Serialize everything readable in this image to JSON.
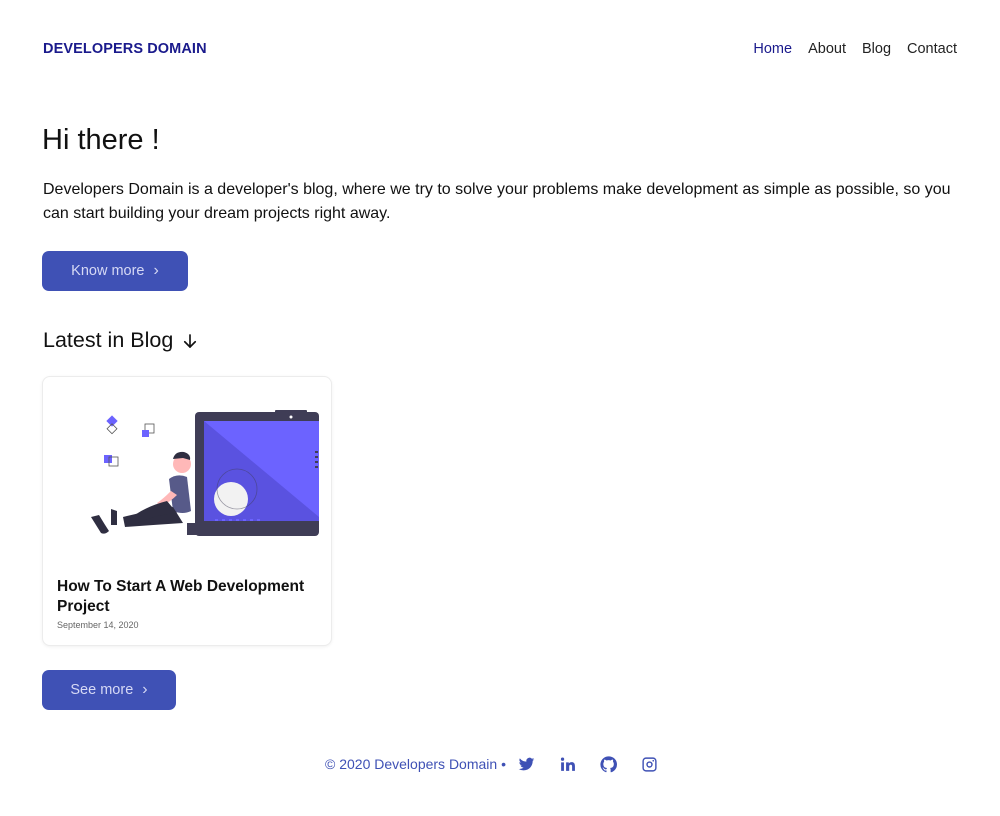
{
  "header": {
    "brand": "DEVELOPERS DOMAIN",
    "nav": [
      {
        "label": "Home",
        "active": true
      },
      {
        "label": "About",
        "active": false
      },
      {
        "label": "Blog",
        "active": false
      },
      {
        "label": "Contact",
        "active": false
      }
    ]
  },
  "hero": {
    "heading": "Hi there !",
    "intro": "Developers Domain is a developer's blog, where we try to solve your problems make development as simple as possible, so you can start building your dream projects right away.",
    "button_label": "Know more",
    "button_icon": "chevron-right-icon"
  },
  "blog": {
    "section_title": "Latest in Blog",
    "section_icon": "arrow-down-icon",
    "posts": [
      {
        "title": "How To Start A Web Development Project",
        "date": "September 14, 2020"
      }
    ],
    "see_more_label": "See more",
    "see_more_icon": "chevron-right-icon"
  },
  "footer": {
    "copyright": "© 2020 Developers Domain •",
    "social": [
      "twitter-icon",
      "linkedin-icon",
      "github-icon",
      "instagram-icon"
    ]
  },
  "colors": {
    "brand": "#1a1a8c",
    "accent": "#3f51b5",
    "illustration": "#6c63ff"
  }
}
